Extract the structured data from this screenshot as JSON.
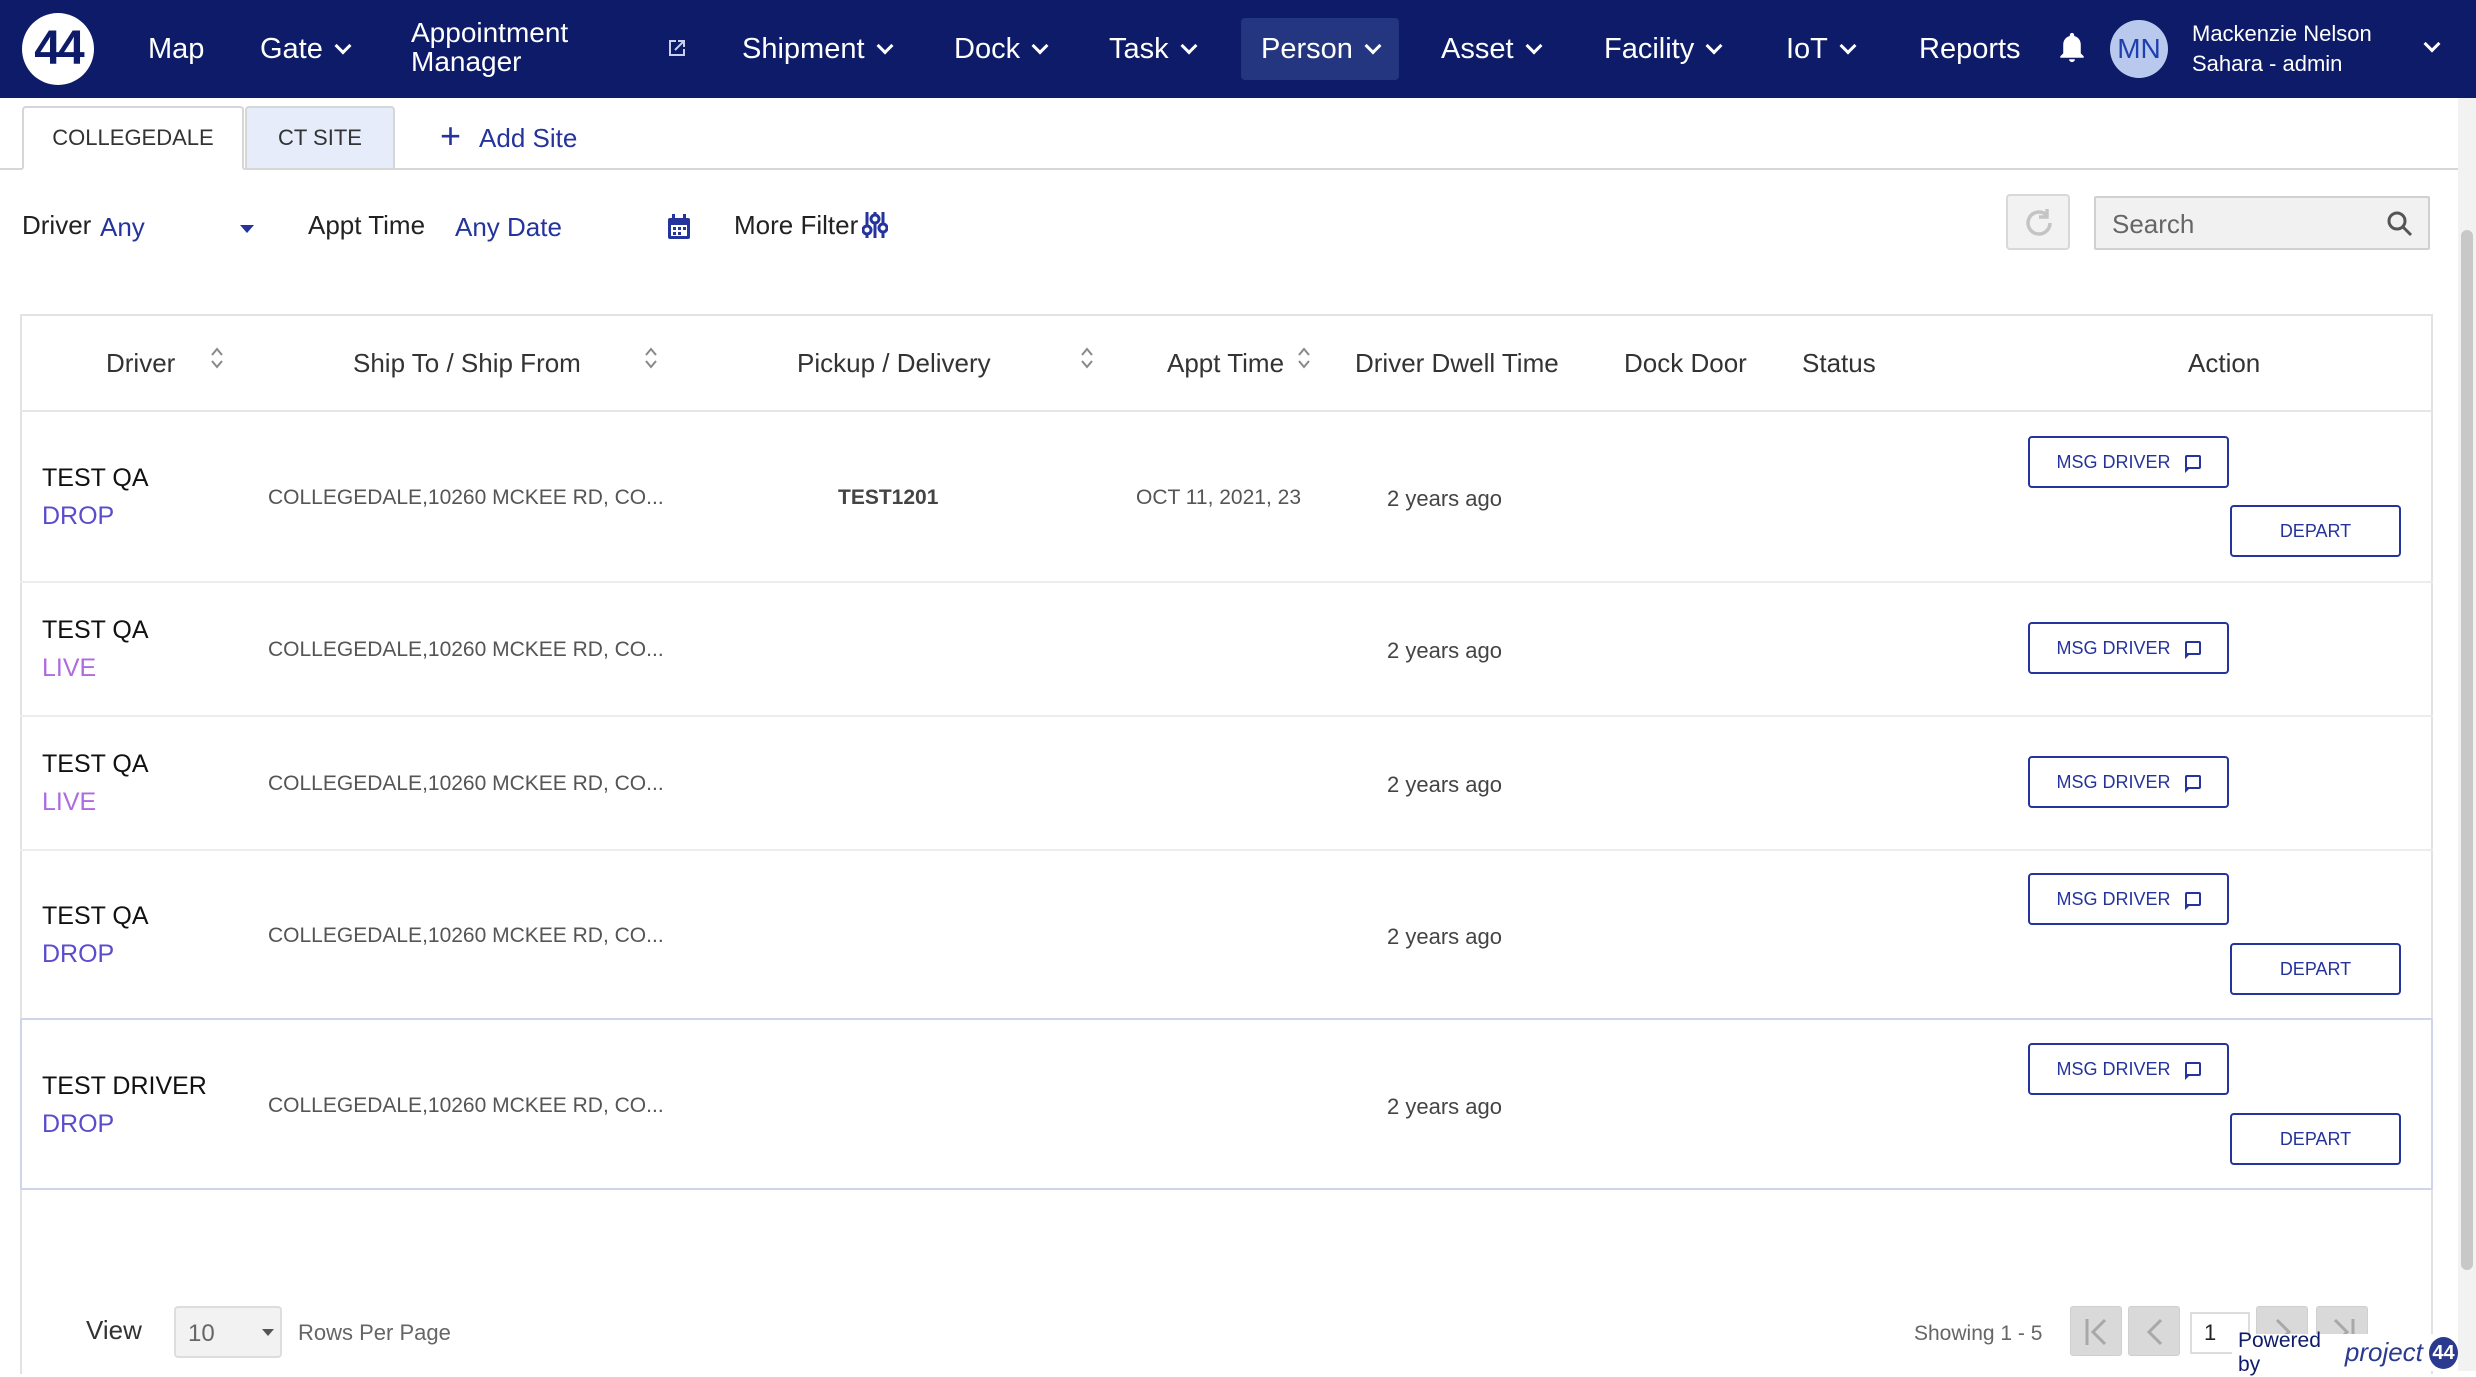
{
  "nav": {
    "logo": "44",
    "items": [
      {
        "label": "Map"
      },
      {
        "label": "Gate"
      },
      {
        "label": "Appointment Manager"
      },
      {
        "label": "Shipment"
      },
      {
        "label": "Dock"
      },
      {
        "label": "Task"
      },
      {
        "label": "Person"
      },
      {
        "label": "Asset"
      },
      {
        "label": "Facility"
      },
      {
        "label": "IoT"
      },
      {
        "label": "Reports"
      }
    ],
    "active": "Person",
    "user": {
      "initials": "MN",
      "name": "Mackenzie Nelson",
      "org": "Sahara - admin"
    }
  },
  "tabs": [
    {
      "label": "COLLEGEDALE"
    },
    {
      "label": "CT SITE"
    }
  ],
  "add_site_label": "Add Site",
  "filters": {
    "driver_label": "Driver",
    "driver_value": "Any",
    "appt_label": "Appt Time",
    "appt_value": "Any Date",
    "more_filter_label": "More Filter",
    "search_placeholder": "Search"
  },
  "table": {
    "columns": [
      "Driver",
      "Ship To / Ship From",
      "Pickup / Delivery",
      "Appt Time",
      "Driver Dwell Time",
      "Dock Door",
      "Status",
      "Action"
    ],
    "rows": [
      {
        "driver": "TEST QA",
        "type": "DROP",
        "address": "COLLEGEDALE,10260 MCKEE RD, CO...",
        "pickup": "TEST1201",
        "appt": "OCT 11, 2021, 23:",
        "dwell": "2 years ago",
        "msg": "MSG DRIVER",
        "depart": "DEPART"
      },
      {
        "driver": "TEST QA",
        "type": "LIVE",
        "address": "COLLEGEDALE,10260 MCKEE RD, CO...",
        "pickup": "",
        "appt": "",
        "dwell": "2 years ago",
        "msg": "MSG DRIVER",
        "depart": ""
      },
      {
        "driver": "TEST QA",
        "type": "LIVE",
        "address": "COLLEGEDALE,10260 MCKEE RD, CO...",
        "pickup": "",
        "appt": "",
        "dwell": "2 years ago",
        "msg": "MSG DRIVER",
        "depart": ""
      },
      {
        "driver": "TEST QA",
        "type": "DROP",
        "address": "COLLEGEDALE,10260 MCKEE RD, CO...",
        "pickup": "",
        "appt": "",
        "dwell": "2 years ago",
        "msg": "MSG DRIVER",
        "depart": "DEPART"
      },
      {
        "driver": "TEST DRIVER",
        "type": "DROP",
        "address": "COLLEGEDALE,10260 MCKEE RD, CO...",
        "pickup": "",
        "appt": "",
        "dwell": "2 years ago",
        "msg": "MSG DRIVER",
        "depart": "DEPART"
      }
    ]
  },
  "footer": {
    "view_label": "View",
    "rows_per_page_value": "10",
    "rows_per_page_label": "Rows Per Page",
    "showing": "Showing 1 - 5",
    "page": "1",
    "powered_by": "Powered by",
    "brand": "project",
    "brand_mark": "44"
  },
  "colors": {
    "nav_bg": "#0d1b68",
    "accent": "#24349c",
    "drop": "#5b4ccc",
    "live": "#b06ae0"
  }
}
